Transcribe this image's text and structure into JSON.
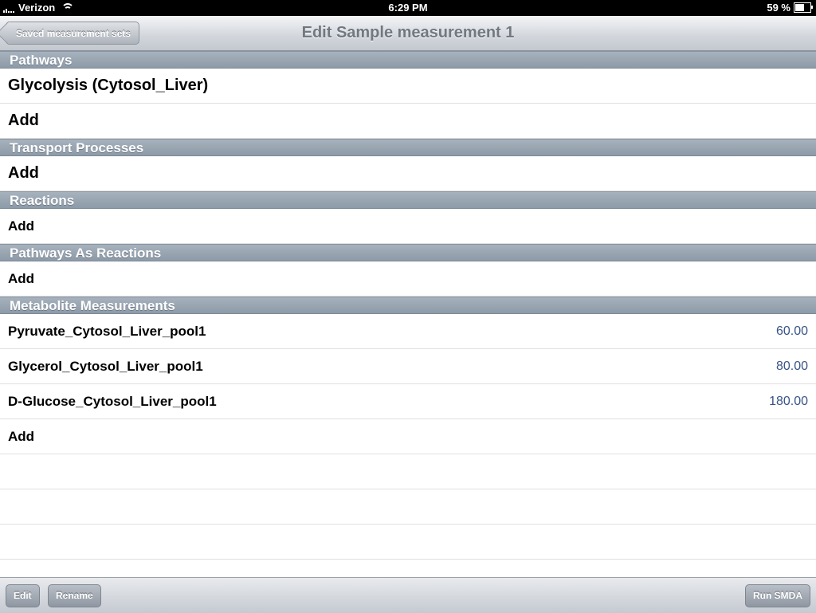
{
  "status_bar": {
    "carrier": "Verizon",
    "time": "6:29 PM",
    "battery": "59 %",
    "battery_level": 0.59
  },
  "nav": {
    "back_label": "Saved measurement sets",
    "title": "Edit Sample measurement 1"
  },
  "sections": [
    {
      "header": "Pathways",
      "rows": [
        {
          "label": "Glycolysis (Cytosol_Liver)",
          "value": ""
        },
        {
          "label": "Add",
          "value": ""
        }
      ]
    },
    {
      "header": "Transport Processes",
      "rows": [
        {
          "label": "Add",
          "value": ""
        }
      ]
    },
    {
      "header": "Reactions",
      "rows": [
        {
          "label": "Add",
          "value": ""
        }
      ]
    },
    {
      "header": "Pathways As Reactions",
      "rows": [
        {
          "label": "Add",
          "value": ""
        }
      ]
    },
    {
      "header": "Metabolite Measurements",
      "rows": [
        {
          "label": "Pyruvate_Cytosol_Liver_pool1",
          "value": "60.00"
        },
        {
          "label": "Glycerol_Cytosol_Liver_pool1",
          "value": "80.00"
        },
        {
          "label": "D-Glucose_Cytosol_Liver_pool1",
          "value": "180.00"
        },
        {
          "label": "Add",
          "value": ""
        }
      ]
    }
  ],
  "toolbar": {
    "edit_label": "Edit",
    "rename_label": "Rename",
    "run_label": "Run SMDA"
  },
  "colors": {
    "value_text": "#385487",
    "section_header": "#97a4b0",
    "nav_title": "#717880"
  }
}
